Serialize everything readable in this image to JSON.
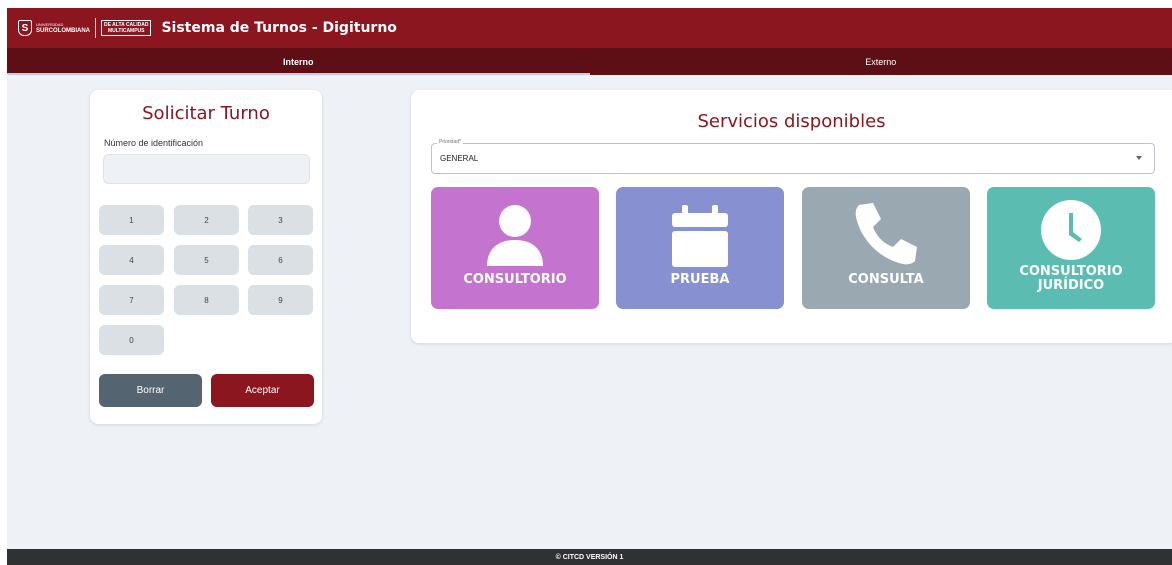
{
  "header": {
    "logo": {
      "university_small": "UNIVERSIDAD",
      "university": "SURCOLOMBIANA",
      "badge_line1": "DE ALTA CALIDAD",
      "badge_line2": "MULTICAMPUS"
    },
    "title": "Sistema de Turnos - Digiturno",
    "brand_color": "#8c1620"
  },
  "tabs": [
    {
      "label": "Interno",
      "active": true
    },
    {
      "label": "Externo",
      "active": false
    }
  ],
  "request_panel": {
    "title": "Solicitar Turno",
    "id_label": "Número de identificación",
    "id_value": "",
    "keys": [
      "1",
      "2",
      "3",
      "4",
      "5",
      "6",
      "7",
      "8",
      "9",
      "0"
    ],
    "clear_label": "Borrar",
    "accept_label": "Aceptar"
  },
  "services_panel": {
    "title": "Servicios disponibles",
    "priority_label": "Prioridad*",
    "priority_value": "GENERAL",
    "services": [
      {
        "label": "CONSULTORIO",
        "icon": "user-icon",
        "color": "#c474cf"
      },
      {
        "label": "PRUEBA",
        "icon": "calendar-icon",
        "color": "#8791d2"
      },
      {
        "label": "CONSULTA",
        "icon": "phone-icon",
        "color": "#9aa8b1"
      },
      {
        "label_line1": "CONSULTORIO",
        "label_line2": "JURÍDICO",
        "icon": "clock-icon",
        "color": "#5bbdb2"
      }
    ]
  },
  "footer": {
    "text": "© CITCD VERSIÓN 1"
  }
}
